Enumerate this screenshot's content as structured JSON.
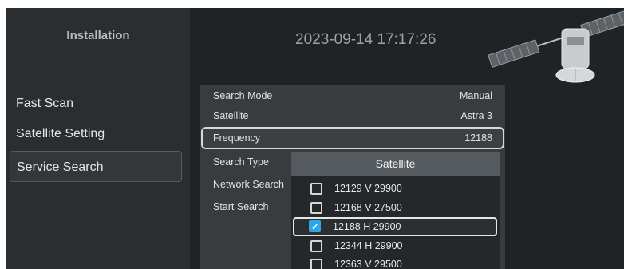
{
  "sidebar": {
    "title": "Installation",
    "items": [
      {
        "label": "Fast Scan"
      },
      {
        "label": "Satellite Setting"
      },
      {
        "label": "Service Search"
      }
    ]
  },
  "header": {
    "datetime": "2023-09-14 17:17:26"
  },
  "settings": {
    "rows": [
      {
        "label": "Search Mode",
        "value": "Manual"
      },
      {
        "label": "Satellite",
        "value": "Astra 3"
      },
      {
        "label": "Frequency",
        "value": "12188"
      },
      {
        "label": "Search Type",
        "value": ""
      },
      {
        "label": "Network Search",
        "value": ""
      },
      {
        "label": "Start Search",
        "value": ""
      }
    ]
  },
  "popup": {
    "title": "Satellite",
    "items": [
      {
        "label": "12129 V 29900",
        "checked": false
      },
      {
        "label": "12168 V 27500",
        "checked": false
      },
      {
        "label": "12188 H 29900",
        "checked": true
      },
      {
        "label": "12344 H 29900",
        "checked": false
      },
      {
        "label": "12363 V 29500",
        "checked": false
      }
    ]
  },
  "icons": {
    "check": "✓",
    "header_art": "satellite-icon"
  },
  "colors": {
    "background": "#202326",
    "sidebar": "#2b2e31",
    "accent": "#2fa6e8"
  }
}
